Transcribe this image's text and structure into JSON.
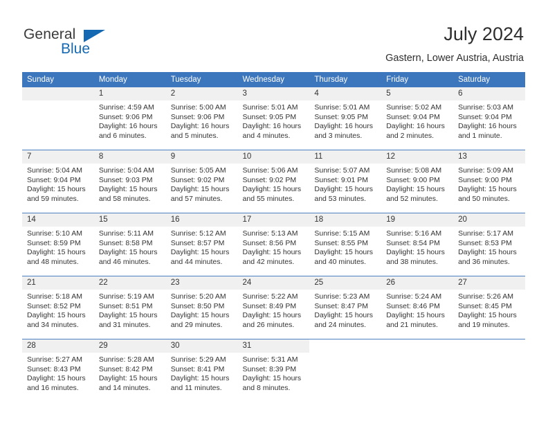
{
  "brand": {
    "name_part1": "General",
    "name_part2": "Blue",
    "triangle_color": "#1569b2"
  },
  "header": {
    "title": "July 2024",
    "subtitle": "Gastern, Lower Austria, Austria"
  },
  "calendar": {
    "header_bg": "#3c76bd",
    "daynum_bg": "#f0f0f0",
    "rule_color": "#4a7fc1",
    "weekdays": [
      "Sunday",
      "Monday",
      "Tuesday",
      "Wednesday",
      "Thursday",
      "Friday",
      "Saturday"
    ],
    "weeks": [
      [
        {
          "day": "",
          "sunrise": "",
          "sunset": "",
          "daylight": "",
          "empty": true
        },
        {
          "day": "1",
          "sunrise": "Sunrise: 4:59 AM",
          "sunset": "Sunset: 9:06 PM",
          "daylight": "Daylight: 16 hours and 6 minutes."
        },
        {
          "day": "2",
          "sunrise": "Sunrise: 5:00 AM",
          "sunset": "Sunset: 9:06 PM",
          "daylight": "Daylight: 16 hours and 5 minutes."
        },
        {
          "day": "3",
          "sunrise": "Sunrise: 5:01 AM",
          "sunset": "Sunset: 9:05 PM",
          "daylight": "Daylight: 16 hours and 4 minutes."
        },
        {
          "day": "4",
          "sunrise": "Sunrise: 5:01 AM",
          "sunset": "Sunset: 9:05 PM",
          "daylight": "Daylight: 16 hours and 3 minutes."
        },
        {
          "day": "5",
          "sunrise": "Sunrise: 5:02 AM",
          "sunset": "Sunset: 9:04 PM",
          "daylight": "Daylight: 16 hours and 2 minutes."
        },
        {
          "day": "6",
          "sunrise": "Sunrise: 5:03 AM",
          "sunset": "Sunset: 9:04 PM",
          "daylight": "Daylight: 16 hours and 1 minute."
        }
      ],
      [
        {
          "day": "7",
          "sunrise": "Sunrise: 5:04 AM",
          "sunset": "Sunset: 9:04 PM",
          "daylight": "Daylight: 15 hours and 59 minutes."
        },
        {
          "day": "8",
          "sunrise": "Sunrise: 5:04 AM",
          "sunset": "Sunset: 9:03 PM",
          "daylight": "Daylight: 15 hours and 58 minutes."
        },
        {
          "day": "9",
          "sunrise": "Sunrise: 5:05 AM",
          "sunset": "Sunset: 9:02 PM",
          "daylight": "Daylight: 15 hours and 57 minutes."
        },
        {
          "day": "10",
          "sunrise": "Sunrise: 5:06 AM",
          "sunset": "Sunset: 9:02 PM",
          "daylight": "Daylight: 15 hours and 55 minutes."
        },
        {
          "day": "11",
          "sunrise": "Sunrise: 5:07 AM",
          "sunset": "Sunset: 9:01 PM",
          "daylight": "Daylight: 15 hours and 53 minutes."
        },
        {
          "day": "12",
          "sunrise": "Sunrise: 5:08 AM",
          "sunset": "Sunset: 9:00 PM",
          "daylight": "Daylight: 15 hours and 52 minutes."
        },
        {
          "day": "13",
          "sunrise": "Sunrise: 5:09 AM",
          "sunset": "Sunset: 9:00 PM",
          "daylight": "Daylight: 15 hours and 50 minutes."
        }
      ],
      [
        {
          "day": "14",
          "sunrise": "Sunrise: 5:10 AM",
          "sunset": "Sunset: 8:59 PM",
          "daylight": "Daylight: 15 hours and 48 minutes."
        },
        {
          "day": "15",
          "sunrise": "Sunrise: 5:11 AM",
          "sunset": "Sunset: 8:58 PM",
          "daylight": "Daylight: 15 hours and 46 minutes."
        },
        {
          "day": "16",
          "sunrise": "Sunrise: 5:12 AM",
          "sunset": "Sunset: 8:57 PM",
          "daylight": "Daylight: 15 hours and 44 minutes."
        },
        {
          "day": "17",
          "sunrise": "Sunrise: 5:13 AM",
          "sunset": "Sunset: 8:56 PM",
          "daylight": "Daylight: 15 hours and 42 minutes."
        },
        {
          "day": "18",
          "sunrise": "Sunrise: 5:15 AM",
          "sunset": "Sunset: 8:55 PM",
          "daylight": "Daylight: 15 hours and 40 minutes."
        },
        {
          "day": "19",
          "sunrise": "Sunrise: 5:16 AM",
          "sunset": "Sunset: 8:54 PM",
          "daylight": "Daylight: 15 hours and 38 minutes."
        },
        {
          "day": "20",
          "sunrise": "Sunrise: 5:17 AM",
          "sunset": "Sunset: 8:53 PM",
          "daylight": "Daylight: 15 hours and 36 minutes."
        }
      ],
      [
        {
          "day": "21",
          "sunrise": "Sunrise: 5:18 AM",
          "sunset": "Sunset: 8:52 PM",
          "daylight": "Daylight: 15 hours and 34 minutes."
        },
        {
          "day": "22",
          "sunrise": "Sunrise: 5:19 AM",
          "sunset": "Sunset: 8:51 PM",
          "daylight": "Daylight: 15 hours and 31 minutes."
        },
        {
          "day": "23",
          "sunrise": "Sunrise: 5:20 AM",
          "sunset": "Sunset: 8:50 PM",
          "daylight": "Daylight: 15 hours and 29 minutes."
        },
        {
          "day": "24",
          "sunrise": "Sunrise: 5:22 AM",
          "sunset": "Sunset: 8:49 PM",
          "daylight": "Daylight: 15 hours and 26 minutes."
        },
        {
          "day": "25",
          "sunrise": "Sunrise: 5:23 AM",
          "sunset": "Sunset: 8:47 PM",
          "daylight": "Daylight: 15 hours and 24 minutes."
        },
        {
          "day": "26",
          "sunrise": "Sunrise: 5:24 AM",
          "sunset": "Sunset: 8:46 PM",
          "daylight": "Daylight: 15 hours and 21 minutes."
        },
        {
          "day": "27",
          "sunrise": "Sunrise: 5:26 AM",
          "sunset": "Sunset: 8:45 PM",
          "daylight": "Daylight: 15 hours and 19 minutes."
        }
      ],
      [
        {
          "day": "28",
          "sunrise": "Sunrise: 5:27 AM",
          "sunset": "Sunset: 8:43 PM",
          "daylight": "Daylight: 15 hours and 16 minutes."
        },
        {
          "day": "29",
          "sunrise": "Sunrise: 5:28 AM",
          "sunset": "Sunset: 8:42 PM",
          "daylight": "Daylight: 15 hours and 14 minutes."
        },
        {
          "day": "30",
          "sunrise": "Sunrise: 5:29 AM",
          "sunset": "Sunset: 8:41 PM",
          "daylight": "Daylight: 15 hours and 11 minutes."
        },
        {
          "day": "31",
          "sunrise": "Sunrise: 5:31 AM",
          "sunset": "Sunset: 8:39 PM",
          "daylight": "Daylight: 15 hours and 8 minutes."
        },
        {
          "day": "",
          "sunrise": "",
          "sunset": "",
          "daylight": "",
          "empty": true,
          "blank": true
        },
        {
          "day": "",
          "sunrise": "",
          "sunset": "",
          "daylight": "",
          "empty": true,
          "blank": true
        },
        {
          "day": "",
          "sunrise": "",
          "sunset": "",
          "daylight": "",
          "empty": true,
          "blank": true
        }
      ]
    ]
  }
}
